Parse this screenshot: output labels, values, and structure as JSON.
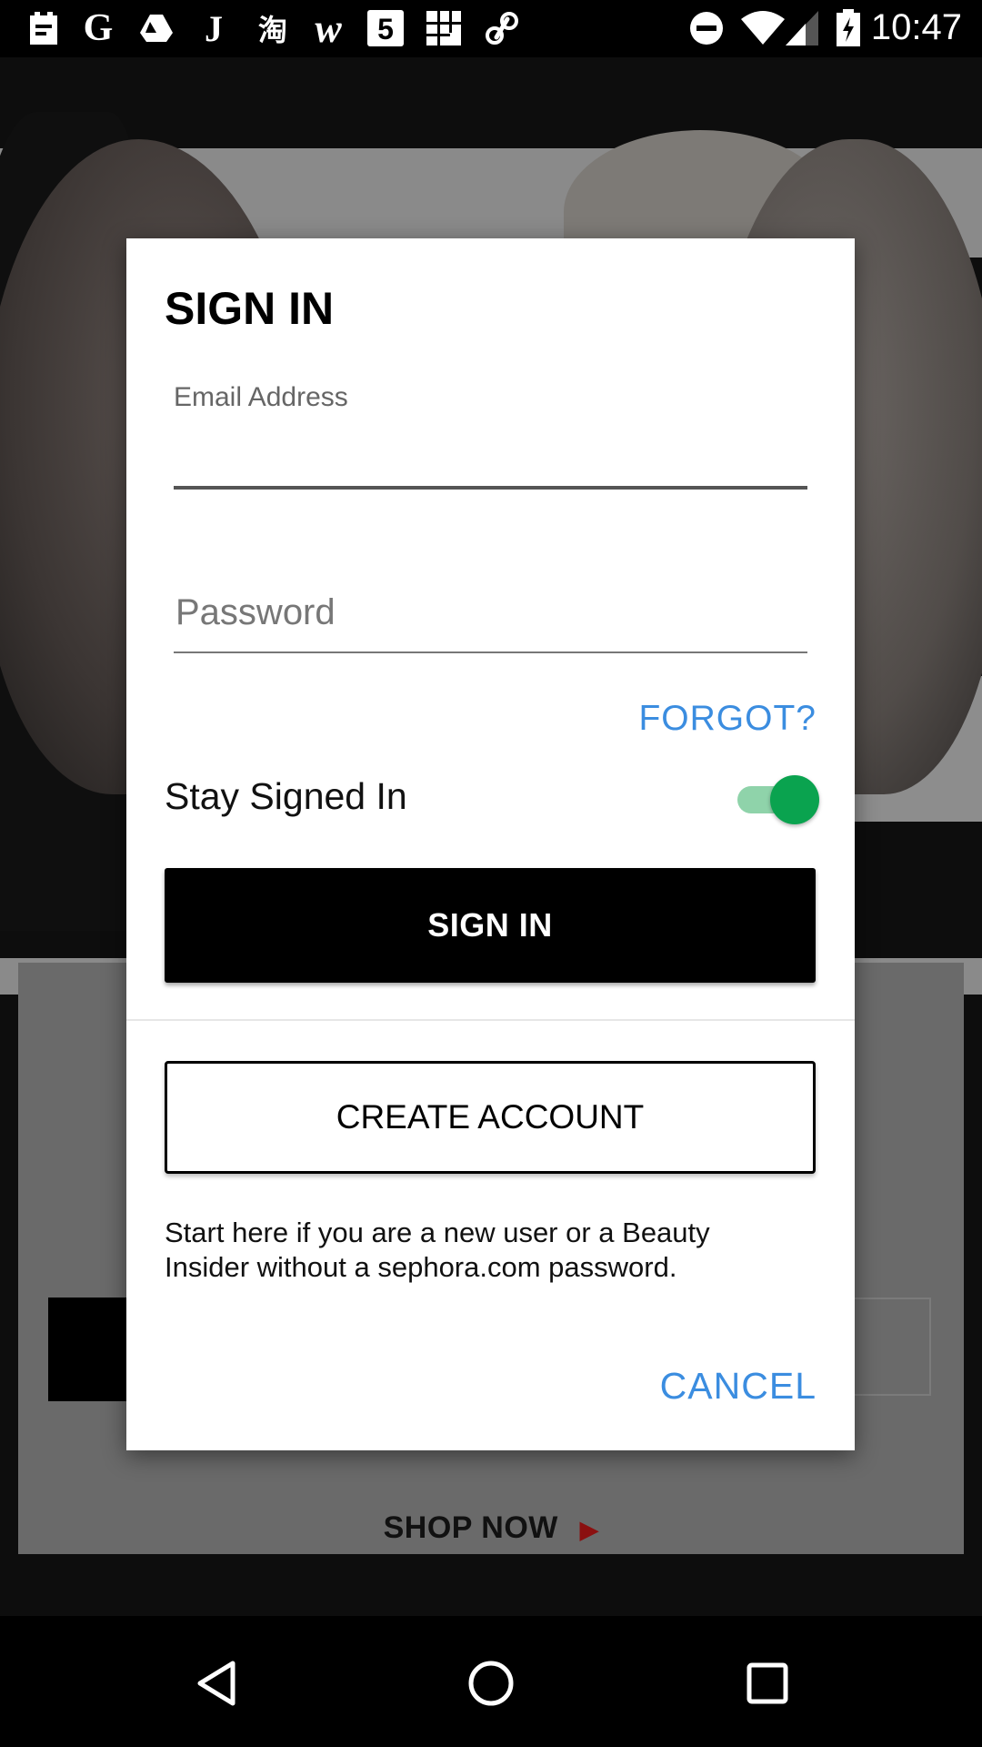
{
  "status_bar": {
    "time": "10:47",
    "left_icons": [
      "notification-icon",
      "google-icon",
      "drive-icon",
      "j-icon",
      "taobao-icon",
      "w-icon",
      "five-icon",
      "grid-icon",
      "link-icon"
    ],
    "right_icons": [
      "do-not-disturb-icon",
      "wifi-icon",
      "signal-icon",
      "battery-icon"
    ]
  },
  "background": {
    "shop_now_label": "SHOP NOW"
  },
  "dialog": {
    "title": "SIGN IN",
    "email_label": "Email Address",
    "email_value": "",
    "password_placeholder": "Password",
    "forgot_label": "FORGOT?",
    "stay_signed_in_label": "Stay Signed In",
    "stay_signed_in": true,
    "sign_in_button": "SIGN IN",
    "create_account_button": "CREATE ACCOUNT",
    "create_account_description": "Start here if you are a new user or a Beauty Insider without a sephora.com password.",
    "cancel_label": "CANCEL"
  },
  "colors": {
    "accent_link": "#3b8de0",
    "toggle_on": "#0aa34f"
  },
  "nav_bar": {
    "icons": [
      "back-icon",
      "home-icon",
      "recents-icon"
    ]
  }
}
